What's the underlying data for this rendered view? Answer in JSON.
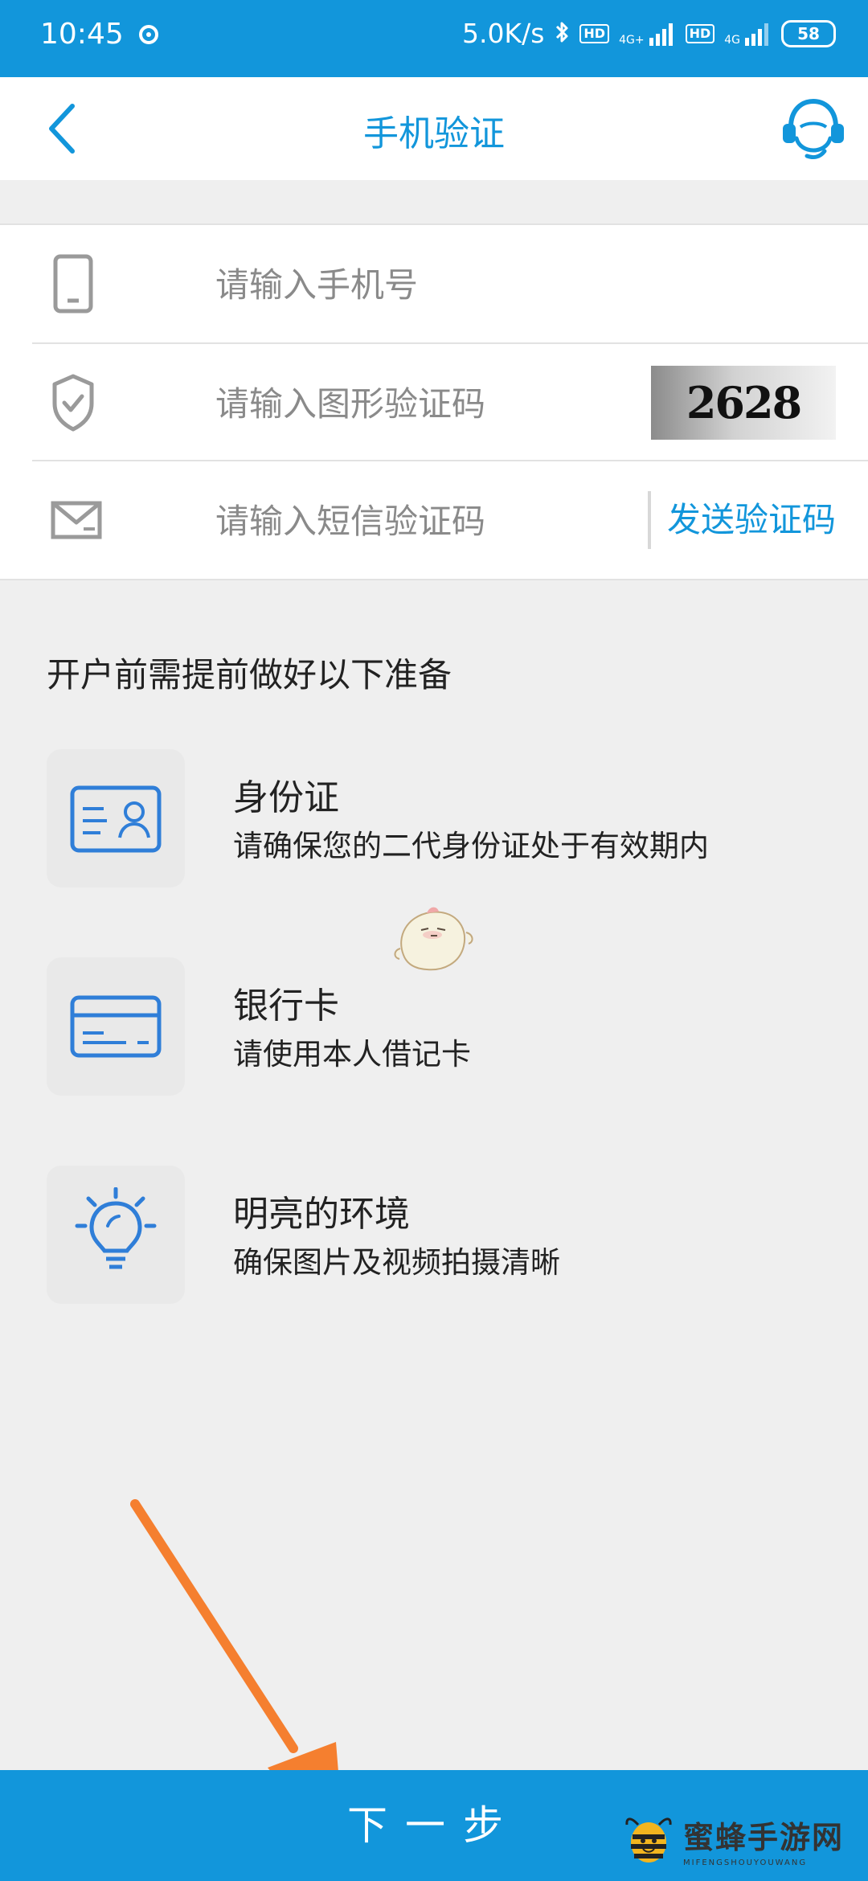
{
  "status_bar": {
    "time": "10:45",
    "network_speed": "5.0K/s",
    "hd_badge": "HD",
    "signal_1_label": "4G+",
    "signal_2_label": "4G",
    "battery": "58"
  },
  "header": {
    "title": "手机验证"
  },
  "form": {
    "phone_placeholder": "请输入手机号",
    "captcha_placeholder": "请输入图形验证码",
    "captcha_code": "2628",
    "sms_placeholder": "请输入短信验证码",
    "send_code_label": "发送验证码"
  },
  "preparation": {
    "title": "开户前需提前做好以下准备",
    "items": [
      {
        "name": "身份证",
        "desc": "请确保您的二代身份证处于有效期内",
        "icon": "id-card-icon"
      },
      {
        "name": "银行卡",
        "desc": "请使用本人借记卡",
        "icon": "bank-card-icon"
      },
      {
        "name": "明亮的环境",
        "desc": "确保图片及视频拍摄清晰",
        "icon": "light-bulb-icon"
      }
    ]
  },
  "footer": {
    "next_button": "下一步"
  },
  "watermark": {
    "main": "蜜蜂手游网",
    "sub": "MIFENGSHOUYOUWANG"
  },
  "colors": {
    "primary": "#1296db",
    "arrow": "#f57f2f",
    "background": "#efefef"
  }
}
